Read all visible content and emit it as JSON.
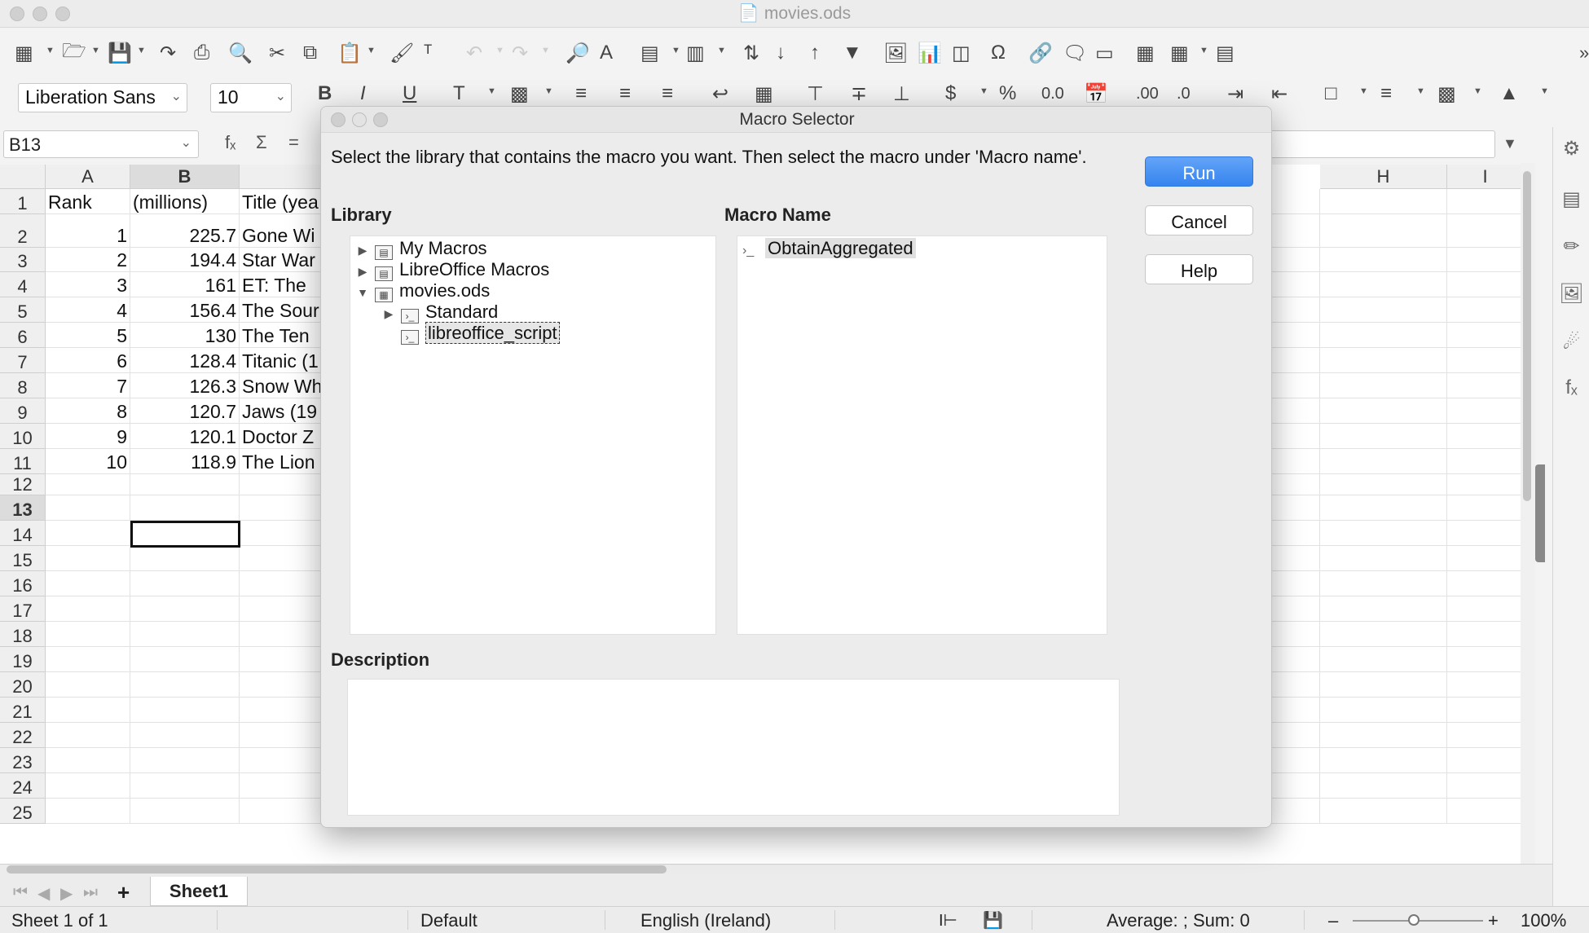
{
  "window": {
    "title": "movies.ods"
  },
  "toolbar": {
    "font_name": "Liberation Sans",
    "font_size": "10"
  },
  "formula_bar": {
    "cell_ref": "B13",
    "fx": "fₓ",
    "sum": "Σ",
    "equals": "="
  },
  "sheet": {
    "columns": [
      "A",
      "B",
      "H",
      "I"
    ],
    "rows": [
      "1",
      "2",
      "3",
      "4",
      "5",
      "6",
      "7",
      "8",
      "9",
      "10",
      "11",
      "12",
      "13",
      "14",
      "15",
      "16",
      "17",
      "18",
      "19",
      "20",
      "21",
      "22",
      "23",
      "24",
      "25"
    ],
    "header_row": {
      "a": "Rank",
      "b": "(millions)",
      "c": "Title (yea"
    },
    "data": [
      {
        "rank": "1",
        "value": "225.7",
        "title": "Gone Wi"
      },
      {
        "rank": "2",
        "value": "194.4",
        "title": "Star War"
      },
      {
        "rank": "3",
        "value": "161",
        "title": "ET: The"
      },
      {
        "rank": "4",
        "value": "156.4",
        "title": "The Sour"
      },
      {
        "rank": "5",
        "value": "130",
        "title": "The Ten"
      },
      {
        "rank": "6",
        "value": "128.4",
        "title": "Titanic (1"
      },
      {
        "rank": "7",
        "value": "126.3",
        "title": "Snow Wh"
      },
      {
        "rank": "8",
        "value": "120.7",
        "title": "Jaws (19"
      },
      {
        "rank": "9",
        "value": "120.1",
        "title": "Doctor Z"
      },
      {
        "rank": "10",
        "value": "118.9",
        "title": "The Lion"
      }
    ]
  },
  "dialog": {
    "title": "Macro Selector",
    "instruction": "Select the library that contains the macro you want. Then select the macro under 'Macro name'.",
    "library_label": "Library",
    "macro_name_label": "Macro Name",
    "description_label": "Description",
    "library_tree": {
      "my_macros": "My Macros",
      "libreoffice_macros": "LibreOffice Macros",
      "movies_ods": "movies.ods",
      "standard": "Standard",
      "libreoffice_script": "libreoffice_script"
    },
    "macros": [
      "ObtainAggregated"
    ],
    "buttons": {
      "run": "Run",
      "cancel": "Cancel",
      "help": "Help"
    }
  },
  "tabs": {
    "sheet1": "Sheet1"
  },
  "status": {
    "sheet_info": "Sheet 1 of 1",
    "page_style": "Default",
    "language": "English (Ireland)",
    "summary": "Average: ; Sum: 0",
    "zoom": "100%"
  }
}
